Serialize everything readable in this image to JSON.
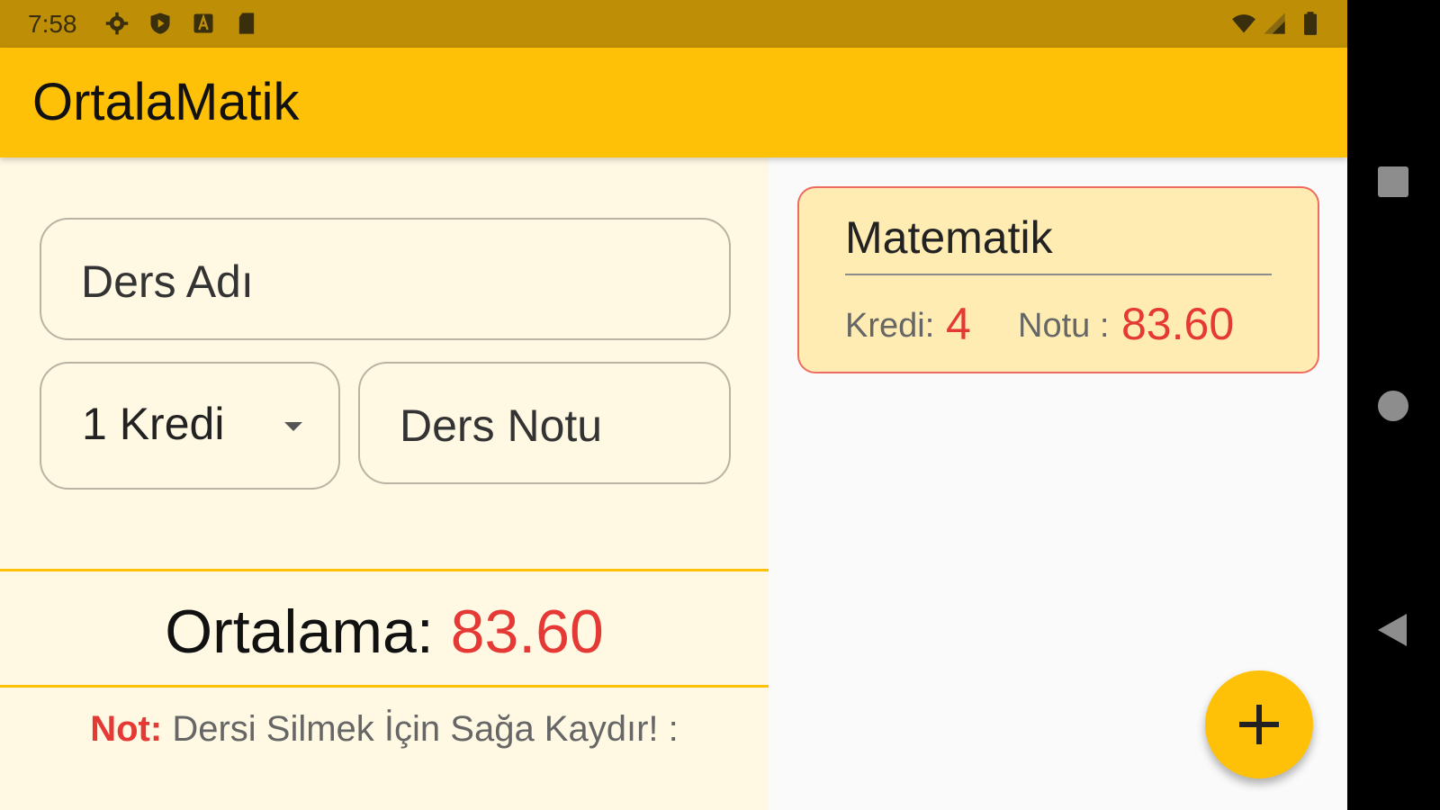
{
  "status_bar": {
    "time": "7:58",
    "icons_left": [
      "settings-icon",
      "play-protect-icon",
      "font-icon",
      "sd-card-icon"
    ],
    "icons_right": [
      "wifi-icon",
      "signal-icon",
      "battery-icon"
    ]
  },
  "app_bar": {
    "title": "OrtalaMatik"
  },
  "form": {
    "course_name_placeholder": "Ders Adı",
    "credit_selected": "1 Kredi",
    "grade_placeholder": "Ders Notu"
  },
  "average": {
    "label": "Ortalama:",
    "value": "83.60"
  },
  "note": {
    "label": "Not:",
    "text": "Dersi Silmek İçin Sağa Kaydır! :"
  },
  "courses": [
    {
      "name": "Matematik",
      "credit_label": "Kredi:",
      "credit": "4",
      "grade_label": "Notu :",
      "grade": "83.60"
    }
  ],
  "fab": {
    "icon": "plus-icon"
  },
  "colors": {
    "primary": "#ffc107",
    "status_bar": "#bd8e06",
    "accent_red": "#e53935",
    "left_panel": "#fff8e3",
    "card_bg": "#ffecb3"
  }
}
